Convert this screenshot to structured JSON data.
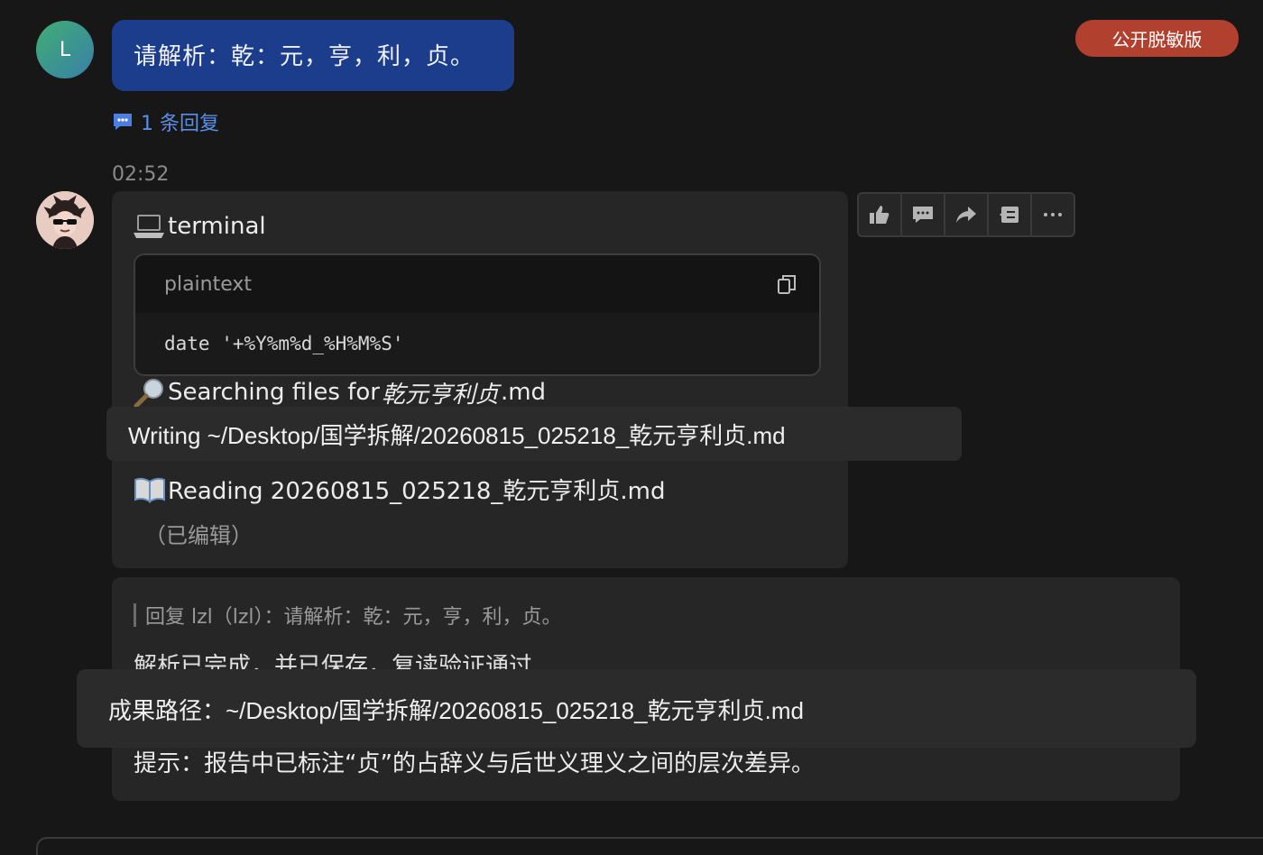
{
  "user_message": {
    "avatar_letter": "L",
    "text": "请解析：乾：元，亨，利，贞。",
    "reply_count_label": "1 条回复"
  },
  "badge": {
    "label": "公开脱敏版",
    "color": "#b1402f"
  },
  "bot_message": {
    "timestamp": "02:52",
    "terminal_label": "terminal",
    "code_block": {
      "language": "plaintext",
      "code": "date '+%Y%m%d_%H%M%S'"
    },
    "searching_prefix": "Searching files for ",
    "searching_name": "乾元亨利贞",
    "searching_ext": ".md",
    "writing_tooltip": "Writing ~/Desktop/国学拆解/20260815_025218_乾元亨利贞.md",
    "reading_line": "Reading 20260815_025218_乾元亨利贞.md",
    "edited_label": "（已编辑）"
  },
  "toolbar": {
    "actions": [
      "thumbs-up",
      "comment",
      "share",
      "quote",
      "more"
    ]
  },
  "reply_card": {
    "quote": "回复 lzl（lzl）：请解析：乾：元，亨，利，贞。",
    "status_line": "解析已完成，并已保存，复读验证通过",
    "path_tooltip": "成果路径：~/Desktop/国学拆解/20260815_025218_乾元亨利贞.md",
    "tip": "提示：报告中已标注“贞”的占辞义与后世义理义之间的层次差异。"
  }
}
